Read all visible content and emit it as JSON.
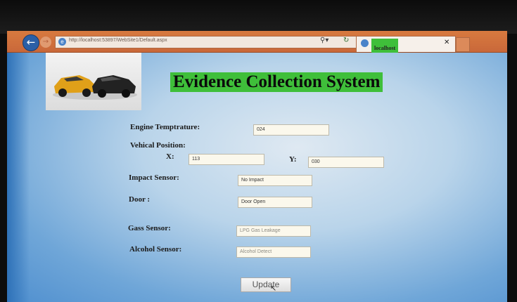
{
  "browser": {
    "url": "http://localhost:53897/WebSite1/Default.aspx",
    "tab_title": "localhost",
    "icons": {
      "back": "back-arrow-icon",
      "forward": "forward-arrow-icon",
      "search": "search-icon",
      "refresh": "refresh-icon",
      "close": "close-icon"
    }
  },
  "page": {
    "title": "Evidence Collection System",
    "logo": "car-crash-image"
  },
  "form": {
    "engine_temp": {
      "label": "Engine Temptrature:",
      "value": "024"
    },
    "vehicle_position": {
      "label": "Vehical Position:",
      "x_label": "X:",
      "x_value": "113",
      "y_label": "Y:",
      "y_value": "030"
    },
    "impact_sensor": {
      "label": "Impact Sensor:",
      "value": "No Impact"
    },
    "door": {
      "label": "Door :",
      "value": "Door Open"
    },
    "gas_sensor": {
      "label": "Gass Sensor:",
      "value": "LPG Gas Leakage"
    },
    "alcohol_sensor": {
      "label": "Alcohol Sensor:",
      "value": "Alcohol Detect"
    }
  },
  "actions": {
    "update_label": "Update"
  },
  "colors": {
    "title_background": "#3fbf3a",
    "browser_chrome": "#d87a3f",
    "page_blue": "#4f8fcf"
  }
}
